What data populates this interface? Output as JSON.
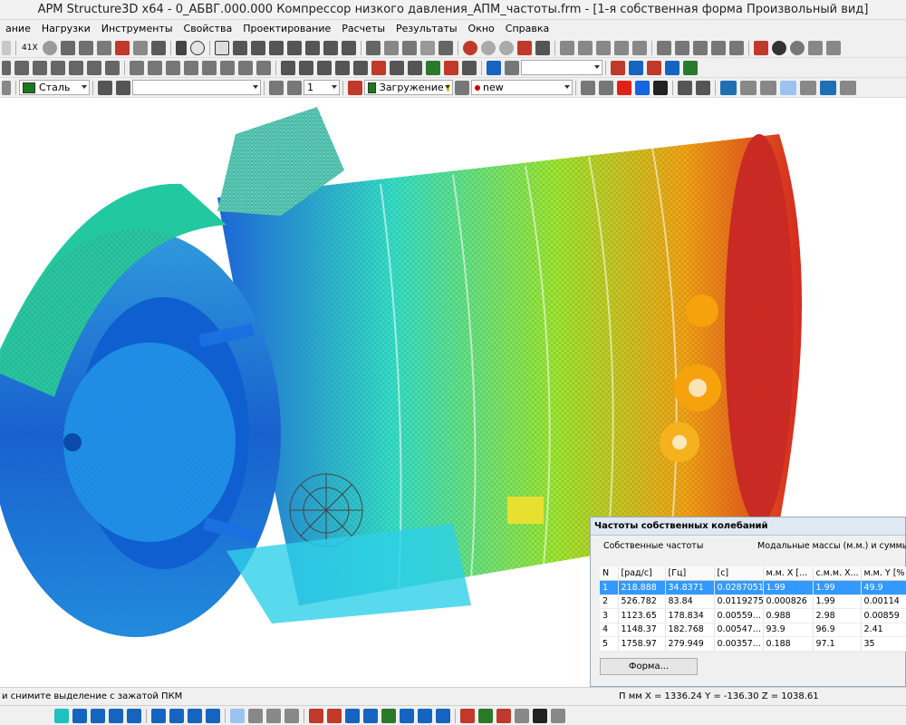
{
  "window": {
    "title": "APM Structure3D x64 - 0_АБВГ.000.000 Компрессор низкого давления_АПМ_частоты.frm - [1-я собственная форма Произвольный вид]"
  },
  "menu": {
    "items": [
      "ание",
      "Нагрузки",
      "Инструменты",
      "Свойства",
      "Проектирование",
      "Расчеты",
      "Результаты",
      "Окно",
      "Справка"
    ]
  },
  "toolbar1": {
    "num_label": "41X"
  },
  "toolbar3": {
    "material_value": "Сталь",
    "section_value": "",
    "number_value": "1",
    "loading_value": "Загружение",
    "new_value": "new",
    "colors": {
      "material": "#1a7a1a",
      "loading": "#1a7a1a",
      "new_dot": "#cc0000"
    }
  },
  "panel": {
    "title": "Частоты собственных колебаний",
    "left_caption": "Собственные частоты",
    "right_caption": "Модальные массы (м.м.) и суммы мод",
    "columns": [
      "N",
      "[рад/с]",
      "[Гц]",
      "[с]",
      "м.м. X [...",
      "с.м.м. X...",
      "м.м. Y [%"
    ],
    "rows": [
      [
        "1",
        "218.888",
        "34.8371",
        "0.0287051",
        "1.99",
        "1.99",
        "49.9"
      ],
      [
        "2",
        "526.782",
        "83.84",
        "0.0119275",
        "0.000826",
        "1.99",
        "0.00114"
      ],
      [
        "3",
        "1123.65",
        "178.834",
        "0.00559...",
        "0.988",
        "2.98",
        "0.00859"
      ],
      [
        "4",
        "1148.37",
        "182.768",
        "0.00547...",
        "93.9",
        "96.9",
        "2.41"
      ],
      [
        "5",
        "1758.97",
        "279.949",
        "0.00357...",
        "0.188",
        "97.1",
        "35"
      ]
    ],
    "selected_row": 0,
    "forma_button": "Форма..."
  },
  "status": {
    "hint": "и снимите выделение с зажатой ПКМ",
    "coords": "П мм X = 1336.24 Y = -136.30 Z = 1038.61"
  },
  "viewport": {
    "colors": {
      "low": "#1565e0",
      "mid": "#2ee0c8",
      "midhigh": "#9be82a",
      "high": "#f5a20c",
      "max": "#e0211a"
    }
  }
}
